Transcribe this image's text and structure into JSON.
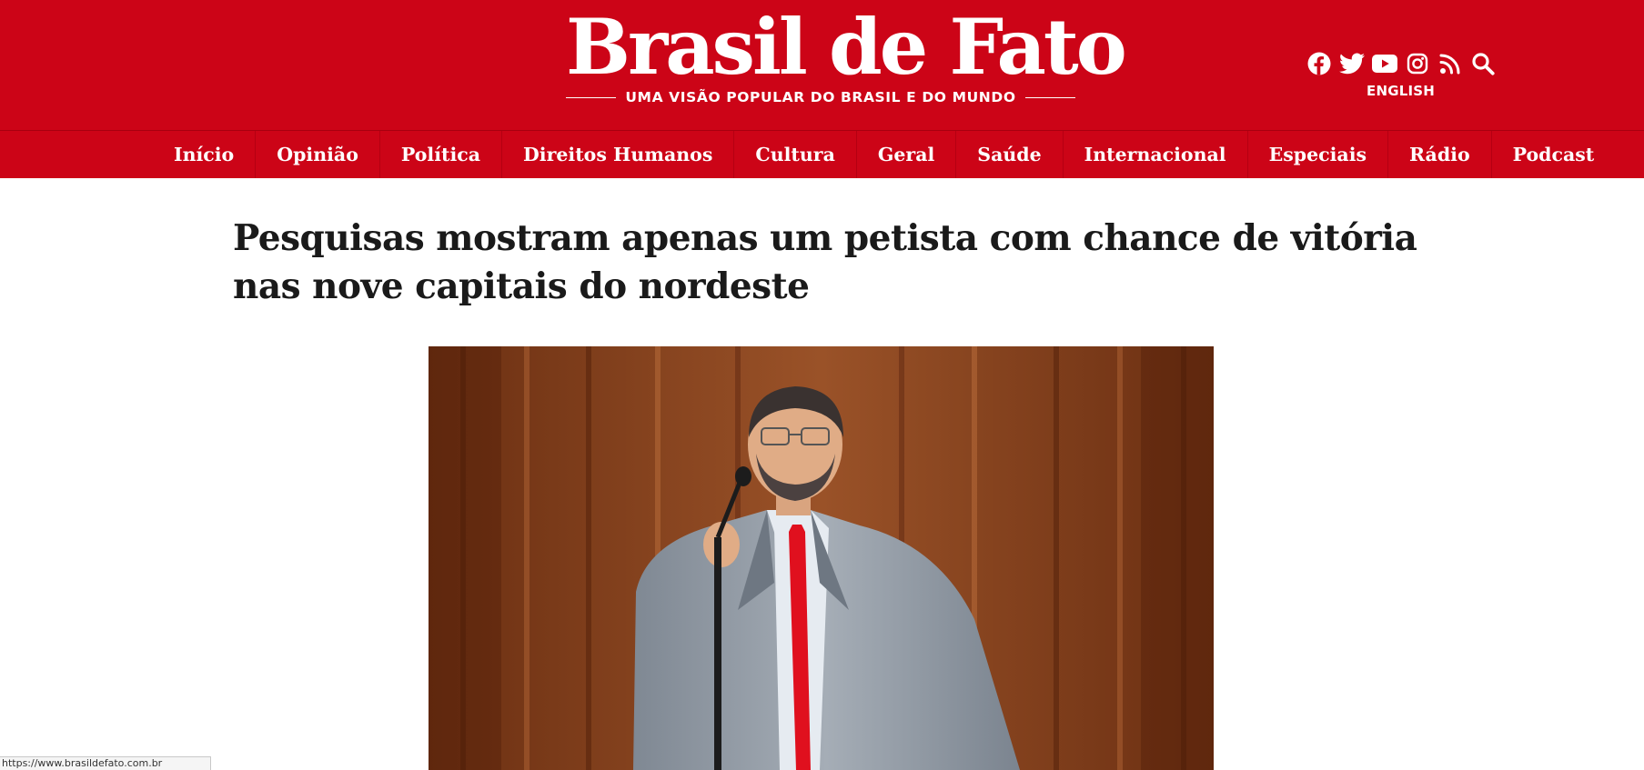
{
  "brand": {
    "name": "Brasil de Fato",
    "tagline": "UMA VISÃO POPULAR DO BRASIL E DO MUNDO",
    "color": "#cc0417"
  },
  "social": [
    "facebook-icon",
    "twitter-icon",
    "youtube-icon",
    "instagram-icon",
    "rss-icon",
    "search-icon"
  ],
  "language_link": "ENGLISH",
  "nav": [
    "Início",
    "Opinião",
    "Política",
    "Direitos Humanos",
    "Cultura",
    "Geral",
    "Saúde",
    "Internacional",
    "Especiais",
    "Rádio",
    "Podcast"
  ],
  "article": {
    "headline": "Pesquisas mostram apenas um petista com chance de vitória nas nove capitais do nordeste"
  },
  "status_bar": {
    "url": "https://www.brasildefato.com.br"
  }
}
